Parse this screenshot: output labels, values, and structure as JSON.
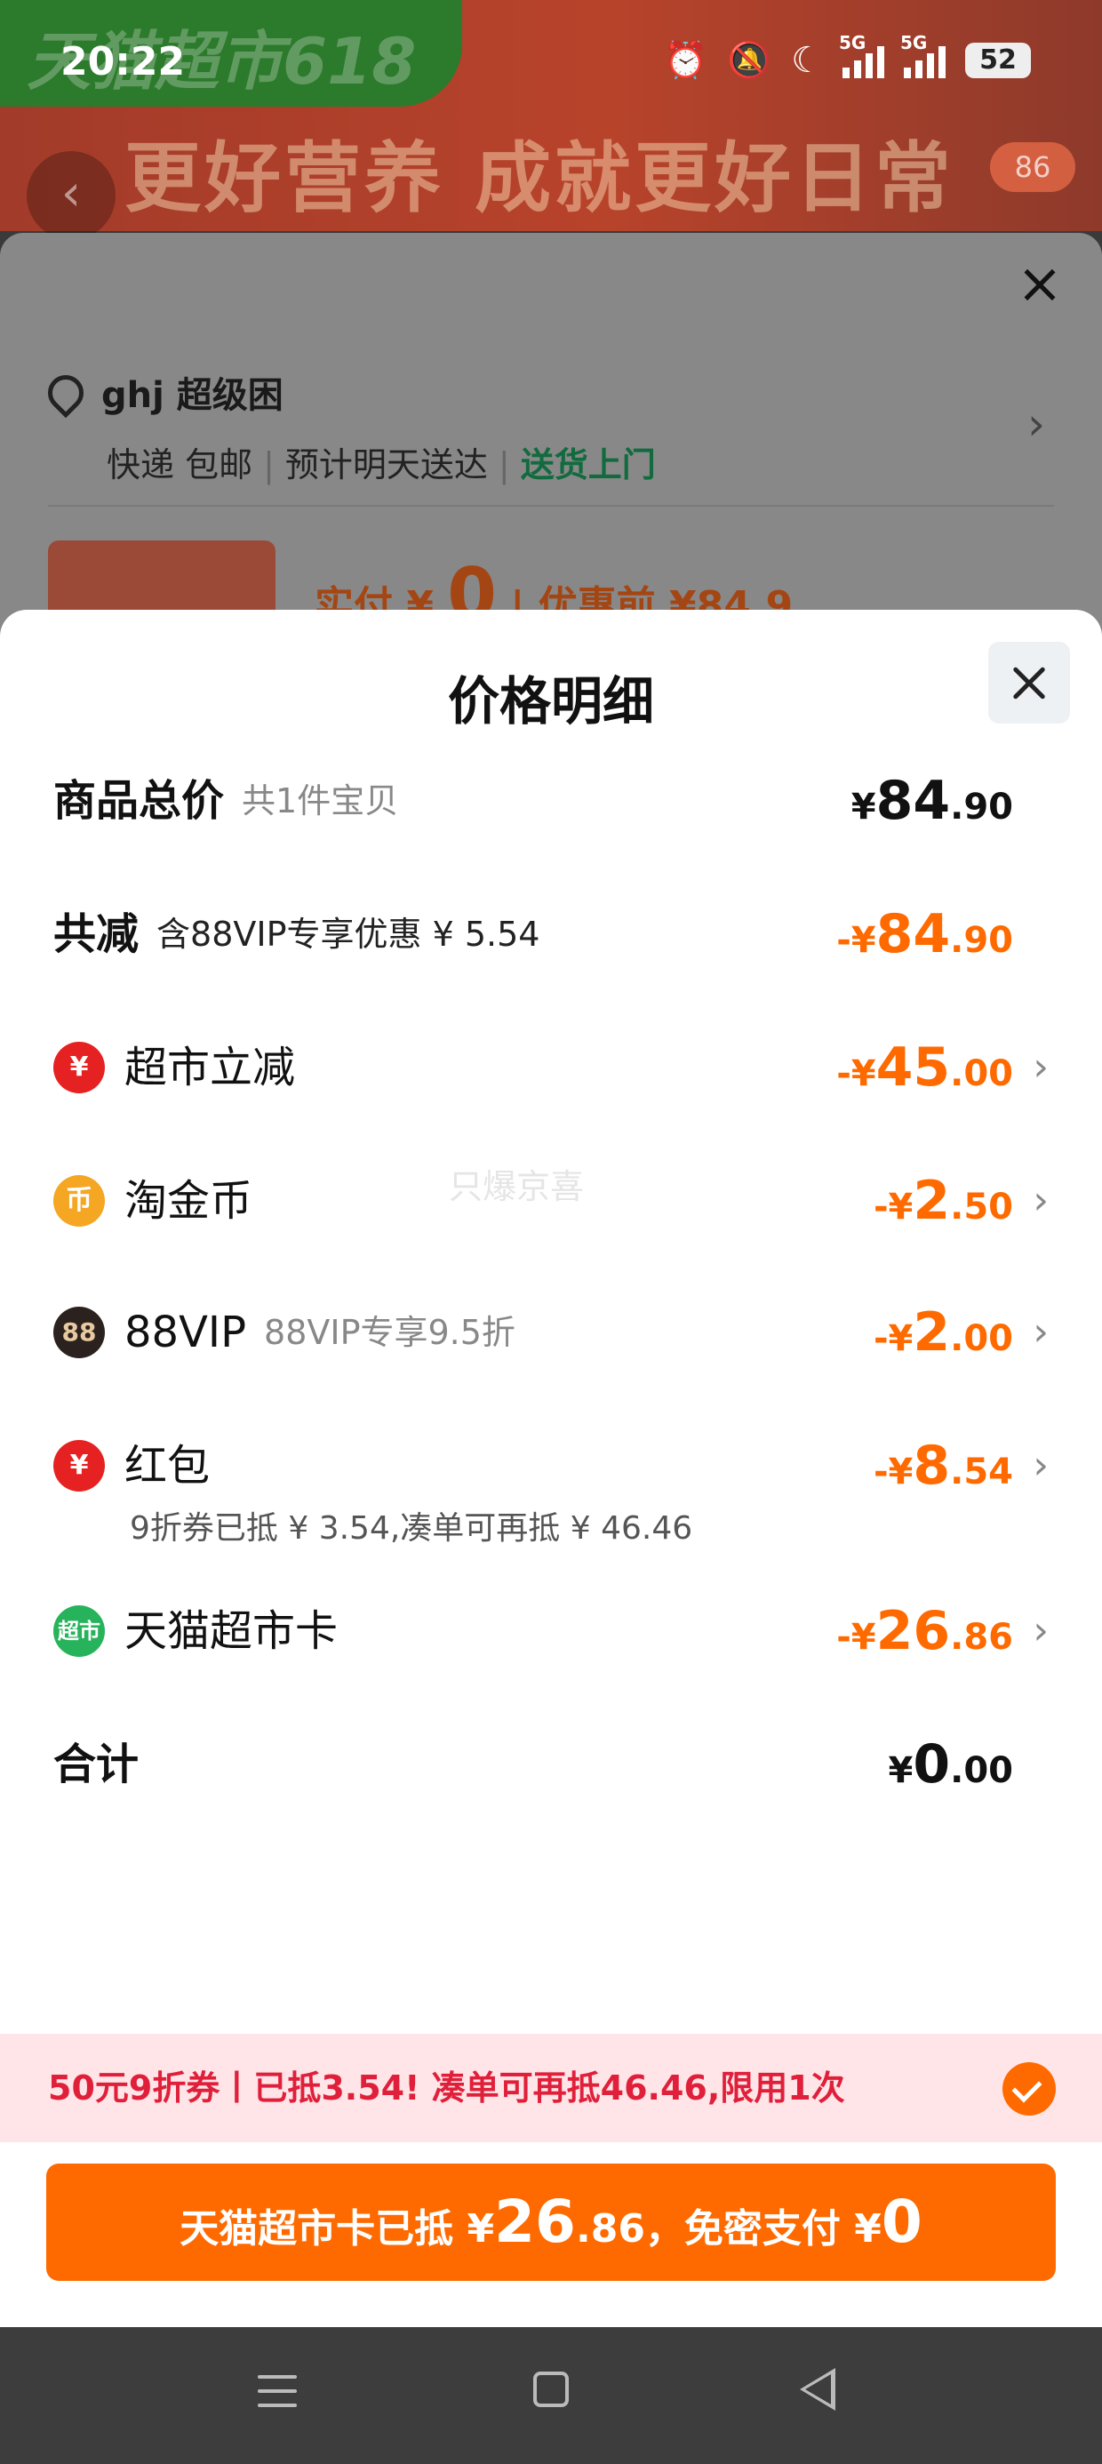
{
  "status_bar": {
    "time": "20:22",
    "battery": "52",
    "network": "5G"
  },
  "background": {
    "banner_title": "天猫超市618",
    "banner_slogan": "更好营养 成就更好日常",
    "cart_count": "86",
    "location_name": "ghj 超级困",
    "shipping_method": "快递 包邮",
    "eta": "预计明天送达",
    "delivery_tag": "送货上门",
    "actual_pay_prefix": "实付 ¥",
    "actual_pay_value": "0",
    "before_discount": "| 优惠前 ¥84.9"
  },
  "sheet": {
    "title": "价格明细",
    "watermark": "只爆京喜",
    "total": {
      "label": "商品总价",
      "sub": "共1件宝贝",
      "cur": "¥",
      "int": "84",
      "dec": ".90"
    },
    "reduce": {
      "label": "共减",
      "sub": "含88VIP专享优惠 ¥ 5.54",
      "cur": "-¥",
      "int": "84",
      "dec": ".90"
    },
    "items": [
      {
        "label": "超市立减",
        "sub": "",
        "cur": "-¥",
        "int": "45",
        "dec": ".00",
        "icon": "yuan-coupon-icon"
      },
      {
        "label": "淘金币",
        "sub": "",
        "cur": "-¥",
        "int": "2",
        "dec": ".50",
        "icon": "coin-icon"
      },
      {
        "label": "88VIP",
        "sub": "88VIP专享9.5折",
        "cur": "-¥",
        "int": "2",
        "dec": ".00",
        "icon": "vip88-icon"
      },
      {
        "label": "红包",
        "sub": "",
        "cur": "-¥",
        "int": "8",
        "dec": ".54",
        "icon": "red-packet-icon"
      },
      {
        "label": "天猫超市卡",
        "sub": "",
        "cur": "-¥",
        "int": "26",
        "dec": ".86",
        "icon": "tmall-card-icon"
      }
    ],
    "redpacket_note": "9折券已抵 ¥ 3.54,凑单可再抵 ¥ 46.46",
    "sum": {
      "label": "合计",
      "cur": "¥",
      "int": "0",
      "dec": ".00"
    }
  },
  "promo": {
    "text": "50元9折券丨已抵3.54! 凑单可再抵46.46,限用1次"
  },
  "pay_button": {
    "prefix": "天猫超市卡已抵 ¥",
    "card_int": "26",
    "card_dec": ".86",
    "mid": "，免密支付 ¥",
    "pay_int": "0"
  },
  "icons": {
    "yuan_glyph": "¥",
    "coin_glyph": "币",
    "vip_glyph": "88",
    "redpacket_glyph": "¥",
    "card_glyph": "超市",
    "back_glyph": "‹",
    "close_glyph": "×",
    "chevron_glyph": "›"
  },
  "colors": {
    "accent": "#ff6a00",
    "promo_text": "#e0203a",
    "promo_bg": "#ffe4e8",
    "delivery_green": "#126b3e"
  }
}
